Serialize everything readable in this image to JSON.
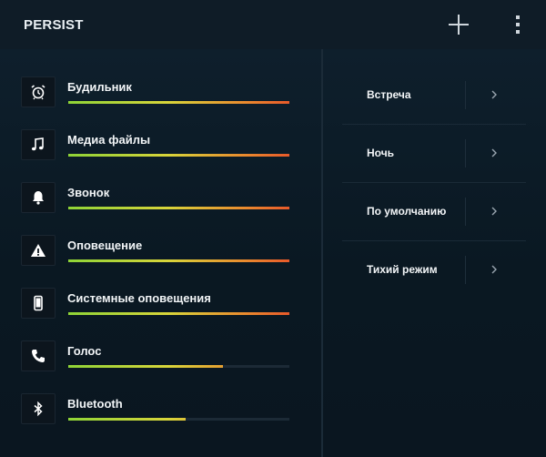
{
  "app": {
    "title": "PERSIST"
  },
  "volumes": [
    {
      "label": "Будильник",
      "icon": "alarm-clock-icon",
      "level": 1.0
    },
    {
      "label": "Медиа файлы",
      "icon": "music-note-icon",
      "level": 1.0
    },
    {
      "label": "Звонок",
      "icon": "bell-icon",
      "level": 1.0
    },
    {
      "label": "Оповещение",
      "icon": "warning-icon",
      "level": 1.0
    },
    {
      "label": "Системные оповещения",
      "icon": "phone-device-icon",
      "level": 1.0
    },
    {
      "label": "Голос",
      "icon": "phone-handset-icon",
      "level": 0.7
    },
    {
      "label": "Bluetooth",
      "icon": "bluetooth-icon",
      "level": 0.53
    }
  ],
  "profiles": [
    {
      "label": "Встреча"
    },
    {
      "label": "Ночь"
    },
    {
      "label": "По умолчанию"
    },
    {
      "label": "Тихий режим"
    }
  ],
  "colors": {
    "background": "#0b1823",
    "appbar": "#0f1c27",
    "level_gradient": [
      "#8fd437",
      "#d8d53a",
      "#ea8a2e",
      "#e85a2a"
    ]
  }
}
